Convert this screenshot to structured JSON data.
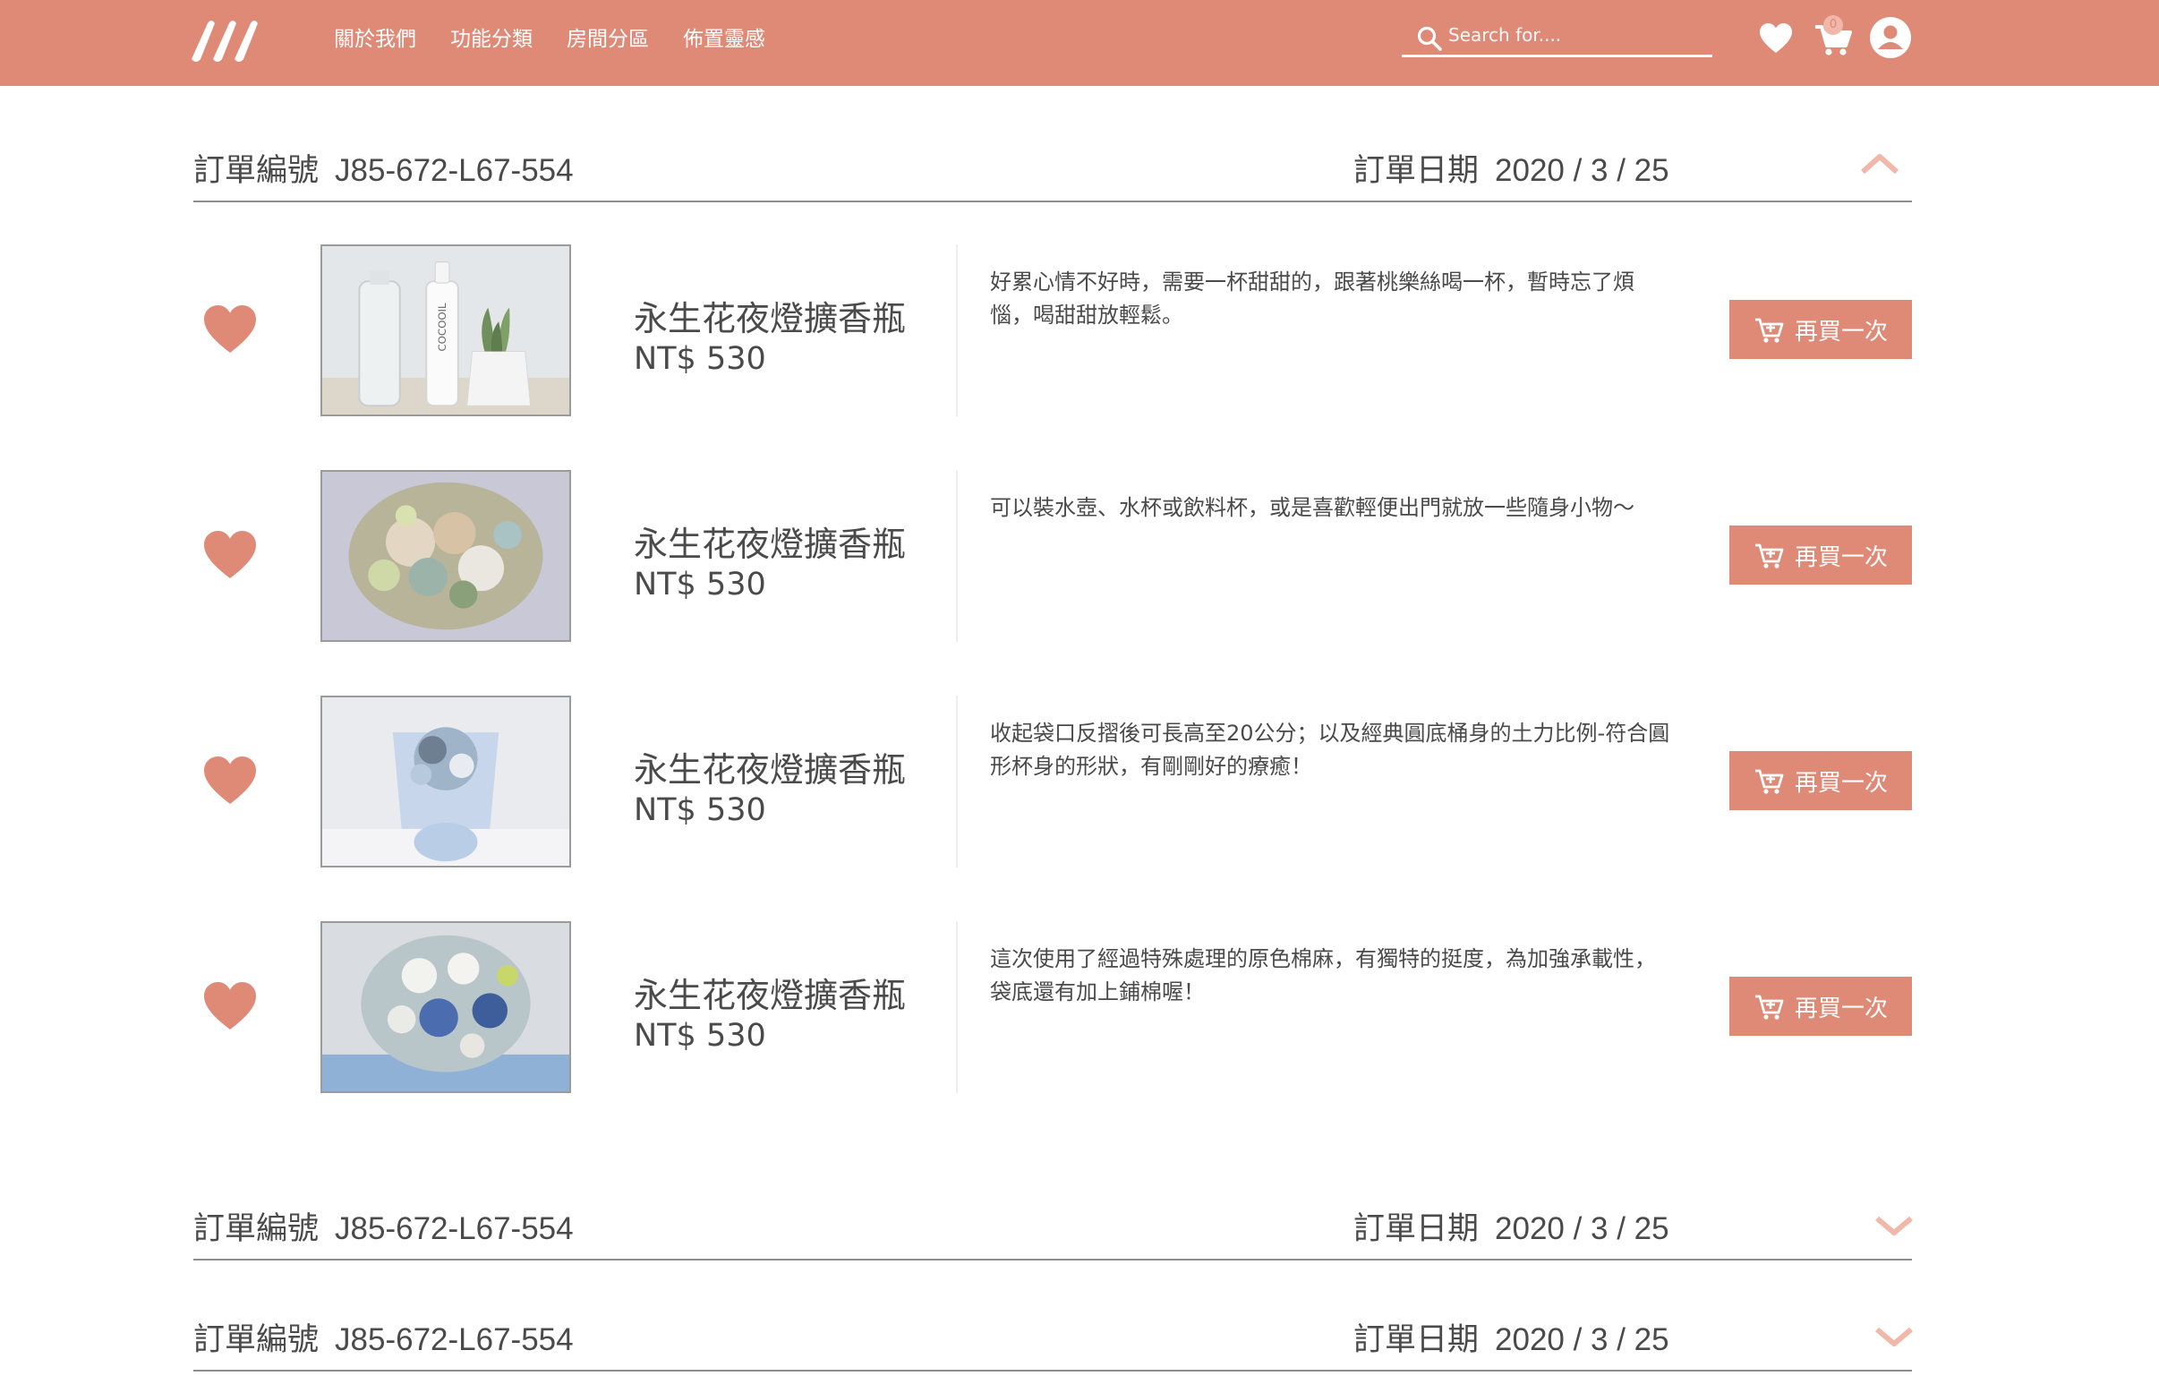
{
  "header": {
    "nav": [
      "關於我們",
      "功能分類",
      "房間分區",
      "佈置靈感"
    ],
    "search_placeholder": "Search for....",
    "cart_count": "0"
  },
  "labels": {
    "order_number": "訂單編號",
    "order_date": "訂單日期",
    "rebuy": "再買一次"
  },
  "colors": {
    "brand": "#de8a76",
    "brand_light": "#f1b7a8"
  },
  "orders": [
    {
      "number": "J85-672-L67-554",
      "date": "2020 / 3 / 25",
      "expanded": true,
      "items": [
        {
          "name": "永生花夜燈擴香瓶",
          "price": "NT$ 530",
          "description": "好累心情不好時，需要一杯甜甜的，跟著桃樂絲喝一杯，暫時忘了煩惱，喝甜甜放輕鬆。",
          "image_text": "COCOOIL"
        },
        {
          "name": "永生花夜燈擴香瓶",
          "price": "NT$ 530",
          "description": "可以裝水壺、水杯或飲料杯，或是喜歡輕便出門就放一些隨身小物～"
        },
        {
          "name": "永生花夜燈擴香瓶",
          "price": "NT$ 530",
          "description": "收起袋口反摺後可長高至20公分；以及經典圓底桶身的土力比例-符合圓形杯身的形狀，有剛剛好的療癒！"
        },
        {
          "name": "永生花夜燈擴香瓶",
          "price": "NT$ 530",
          "description": "這次使用了經過特殊處理的原色棉麻，有獨特的挺度，為加強承載性，袋底還有加上鋪棉喔！"
        }
      ]
    },
    {
      "number": "J85-672-L67-554",
      "date": "2020 / 3 / 25",
      "expanded": false
    },
    {
      "number": "J85-672-L67-554",
      "date": "2020 / 3 / 25",
      "expanded": false
    }
  ]
}
